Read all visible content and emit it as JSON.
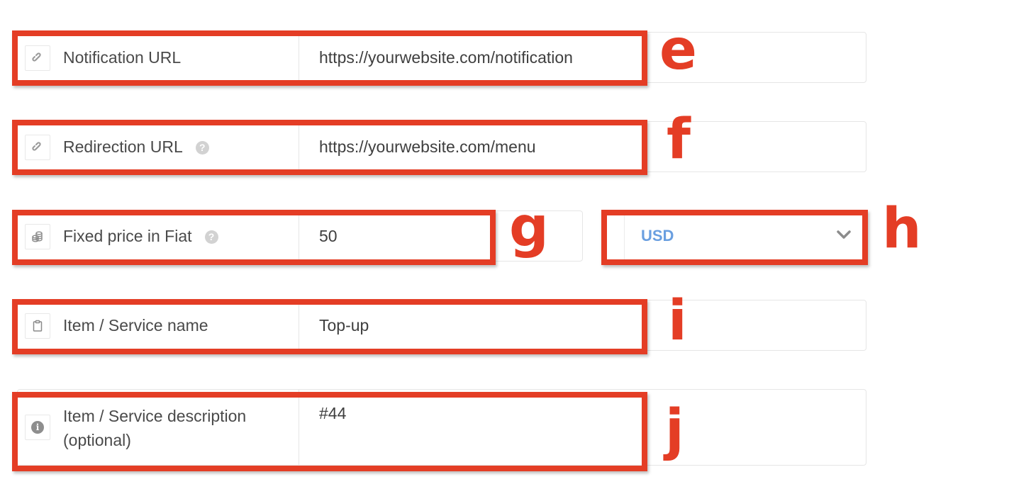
{
  "fields": [
    {
      "id": "e",
      "label": "Notification URL",
      "icon": "link-icon",
      "help": false,
      "value": "https://yourwebsite.com/notification"
    },
    {
      "id": "f",
      "label": "Redirection URL",
      "icon": "link-icon",
      "help": true,
      "value": "https://yourwebsite.com/menu"
    },
    {
      "id": "g",
      "label": "Fixed price in Fiat",
      "icon": "coins-icon",
      "help": true,
      "value": "50"
    },
    {
      "id": "i",
      "label": "Item / Service name",
      "icon": "clipboard-icon",
      "help": false,
      "value": "Top-up"
    },
    {
      "id": "j",
      "label": "Item / Service description (optional)",
      "label_line1": "Item / Service description",
      "label_line2": "(optional)",
      "icon": "info-icon",
      "help": false,
      "value": "#44"
    }
  ],
  "currency_select": {
    "id": "h",
    "selected": "USD"
  },
  "annotations": [
    "e",
    "f",
    "g",
    "h",
    "i",
    "j"
  ],
  "help_glyph": "?",
  "info_glyph": "i",
  "colors": {
    "annotation": "#e43d25",
    "currency_text": "#6a9fe0",
    "border": "#e6e6e6"
  }
}
